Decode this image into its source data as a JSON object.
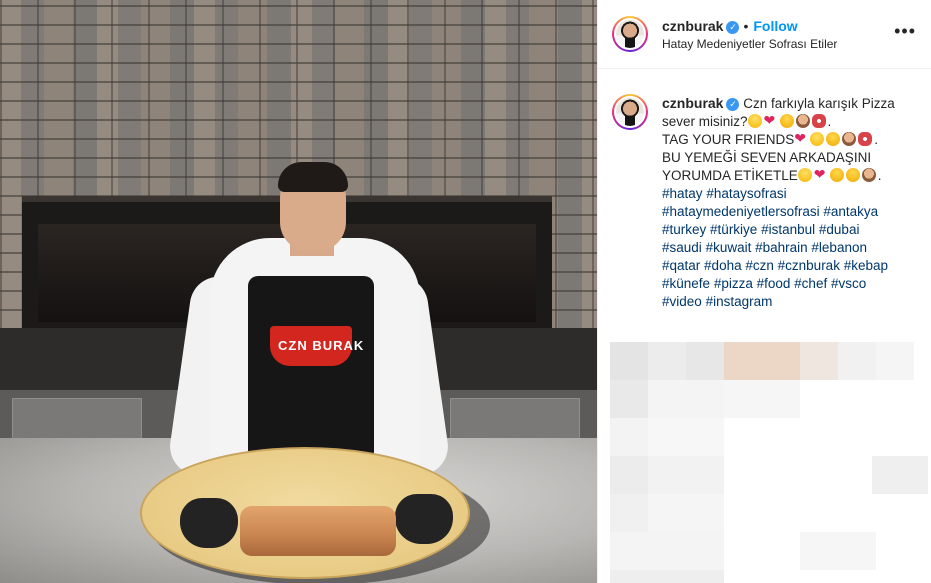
{
  "post": {
    "username": "cznburak",
    "verified_icon": "verified-badge-icon",
    "separator": "•",
    "follow_label": "Follow",
    "location": "Hatay Medeniyetler Sofrası Etiler",
    "more_icon": "more-options-icon",
    "more_label": "•••"
  },
  "media": {
    "apron_text": "CZN BURAK"
  },
  "caption": {
    "username": "cznburak",
    "line1": "Czn farkıyla karışık Pizza",
    "line2": "sever misiniz?",
    "line3": "TAG YOUR FRIENDS",
    "line4": "BU YEMEĞİ SEVEN ARKADAŞINI",
    "line5": "YORUMDA ETİKETLE",
    "hashtag_lines": [
      [
        "#hatay",
        "#hataysofrasi"
      ],
      [
        "#hataymedeniyetlersofrasi",
        "#antakya"
      ],
      [
        "#turkey",
        "#türkiye",
        "#istanbul",
        "#dubai"
      ],
      [
        "#saudi",
        "#kuwait",
        "#bahrain",
        "#lebanon"
      ],
      [
        "#qatar",
        "#doha",
        "#czn",
        "#cznburak",
        "#kebap"
      ],
      [
        "#künefe",
        "#pizza",
        "#food",
        "#chef",
        "#vsco"
      ],
      [
        "#video",
        "#instagram"
      ]
    ]
  },
  "colors": {
    "link": "#0095f6",
    "hashtag": "#00376b",
    "text": "#262626",
    "border": "#efefef"
  }
}
